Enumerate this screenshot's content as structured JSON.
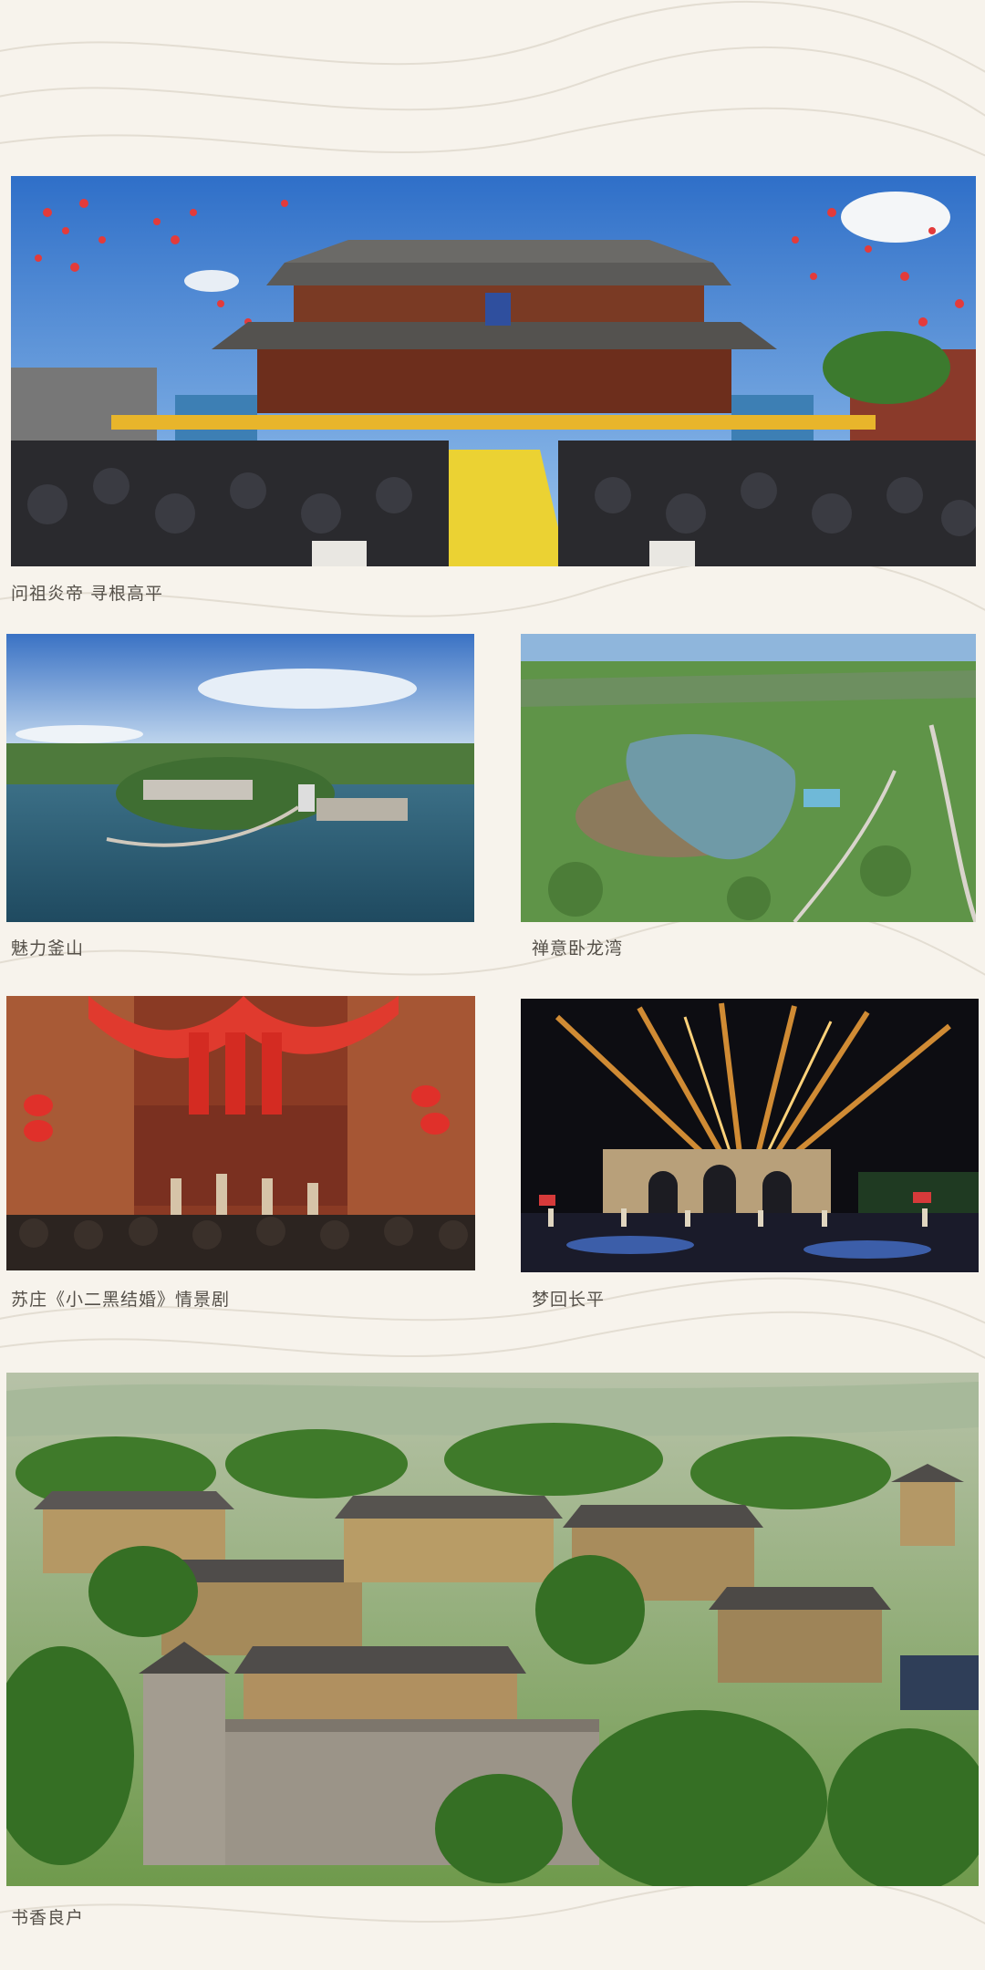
{
  "colors": {
    "page_background": "#f7f3ec",
    "caption_text": "#555049"
  },
  "photos": [
    {
      "caption": "问祖炎帝  寻根高平",
      "scene": "temple-ceremony"
    },
    {
      "caption": "魅力釜山",
      "scene": "reservoir-town"
    },
    {
      "caption": "禅意卧龙湾",
      "scene": "mountain-lake"
    },
    {
      "caption": "苏庄《小二黑结婚》情景剧",
      "scene": "courtyard-performance"
    },
    {
      "caption": "梦回长平",
      "scene": "night-gate-show"
    },
    {
      "caption": "书香良户",
      "scene": "ancient-village"
    }
  ]
}
